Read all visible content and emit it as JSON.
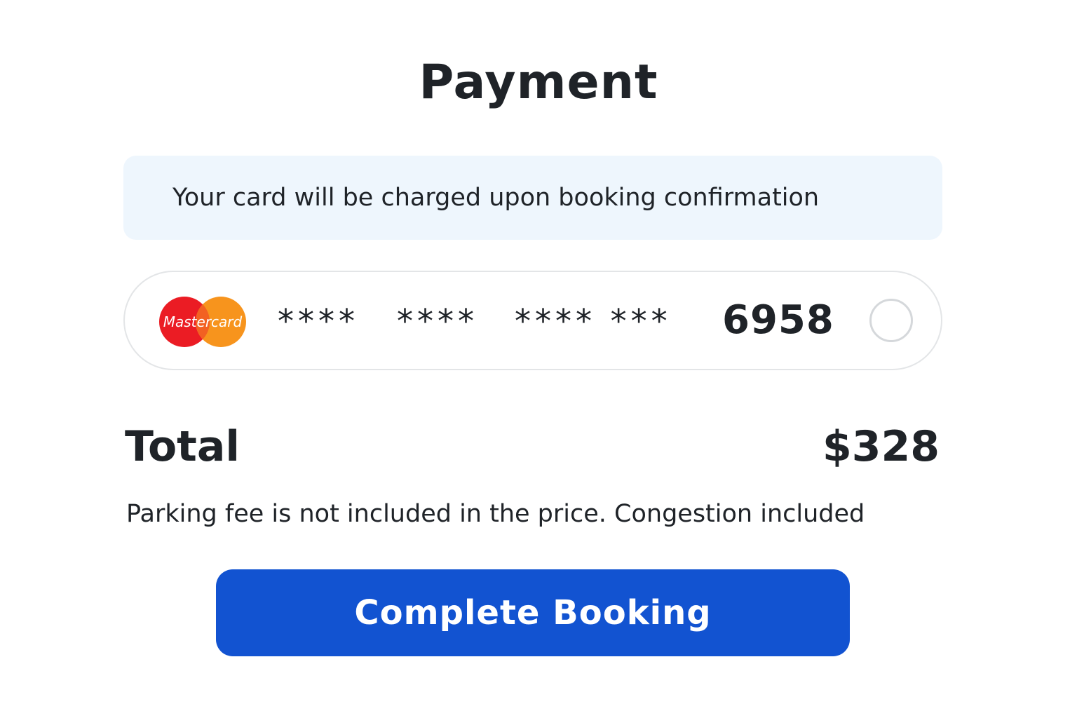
{
  "page": {
    "title": "Payment"
  },
  "notice": {
    "text": "Your card will be charged upon booking confirmation"
  },
  "card": {
    "brand": "Mastercard",
    "mask_groups": [
      "****",
      "****",
      "**** ***"
    ],
    "last4": "6958",
    "selected": false
  },
  "summary": {
    "total_label": "Total",
    "total_value": "$328",
    "note": "Parking fee is not included in the price. Congestion included"
  },
  "actions": {
    "complete_label": "Complete Booking"
  },
  "colors": {
    "accent": "#1253d1",
    "notice_bg": "#eef6fd",
    "mastercard_red": "#eb001b",
    "mastercard_orange": "#f79e1b",
    "text": "#1f2328"
  }
}
